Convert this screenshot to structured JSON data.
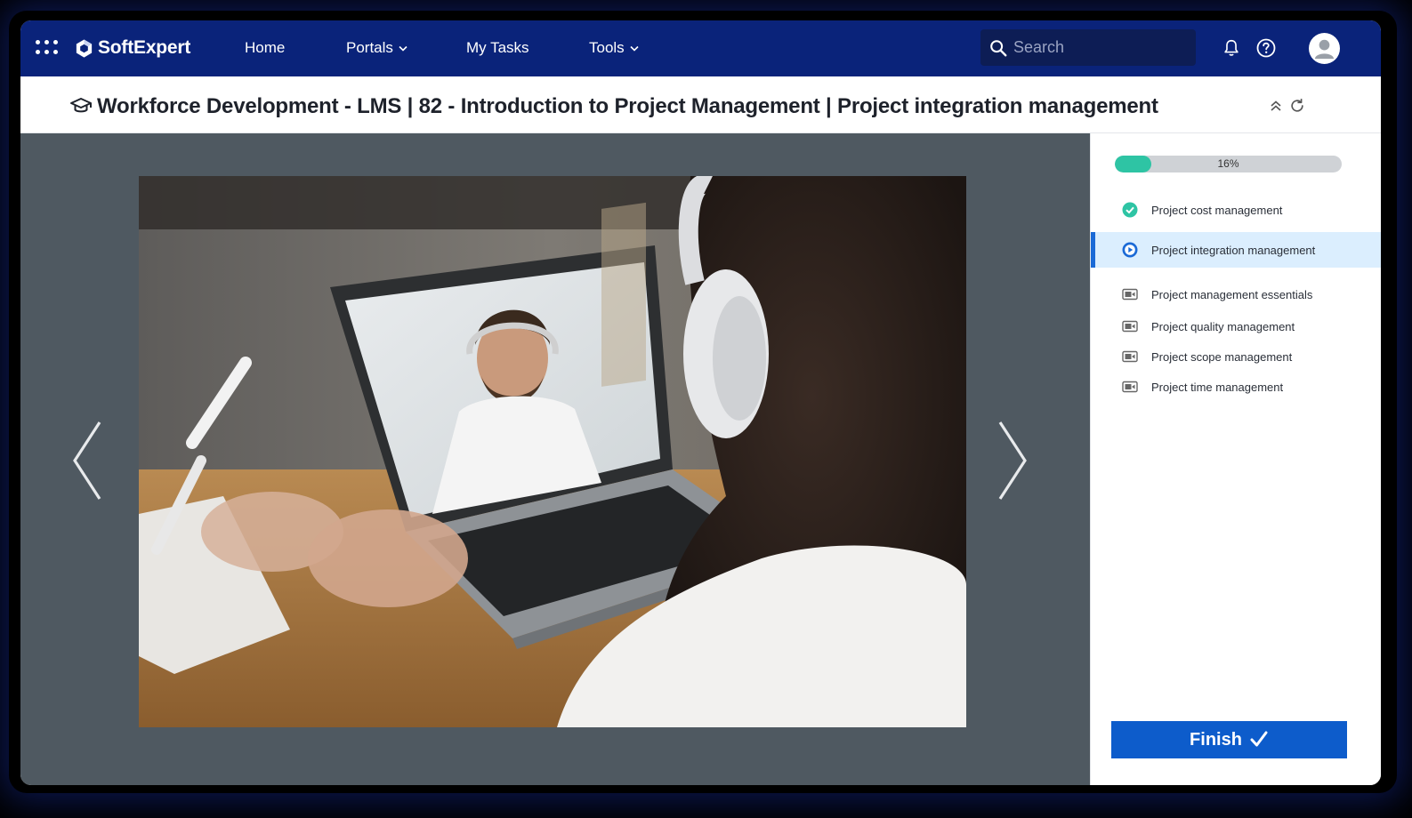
{
  "header": {
    "brand": "SoftExpert",
    "nav": [
      {
        "label": "Home",
        "has_dropdown": false
      },
      {
        "label": "Portals",
        "has_dropdown": true
      },
      {
        "label": "My Tasks",
        "has_dropdown": false
      },
      {
        "label": "Tools",
        "has_dropdown": true
      }
    ],
    "search": {
      "placeholder": "Search",
      "value": ""
    }
  },
  "page": {
    "title": "Workforce Development - LMS | 82 - Introduction to Project Management | Project integration management"
  },
  "course": {
    "progress_percent": 16,
    "progress_label": "16%",
    "items": [
      {
        "label": "Project cost management",
        "status": "completed",
        "icon": "check-circle-icon"
      },
      {
        "label": "Project integration management",
        "status": "in-progress",
        "icon": "play-circle-icon"
      },
      {
        "label": "Project management essentials",
        "status": "not-started",
        "icon": "video-icon"
      },
      {
        "label": "Project quality management",
        "status": "not-started",
        "icon": "video-icon"
      },
      {
        "label": "Project scope management",
        "status": "not-started",
        "icon": "video-icon"
      },
      {
        "label": "Project time management",
        "status": "not-started",
        "icon": "video-icon"
      }
    ],
    "finish_label": "Finish"
  },
  "colors": {
    "nav_bg": "#0a237a",
    "viewer_bg": "#4f5961",
    "progress": "#2ec4a4",
    "active_item_bg": "#dbeefe",
    "primary_button": "#0d5ccb"
  }
}
